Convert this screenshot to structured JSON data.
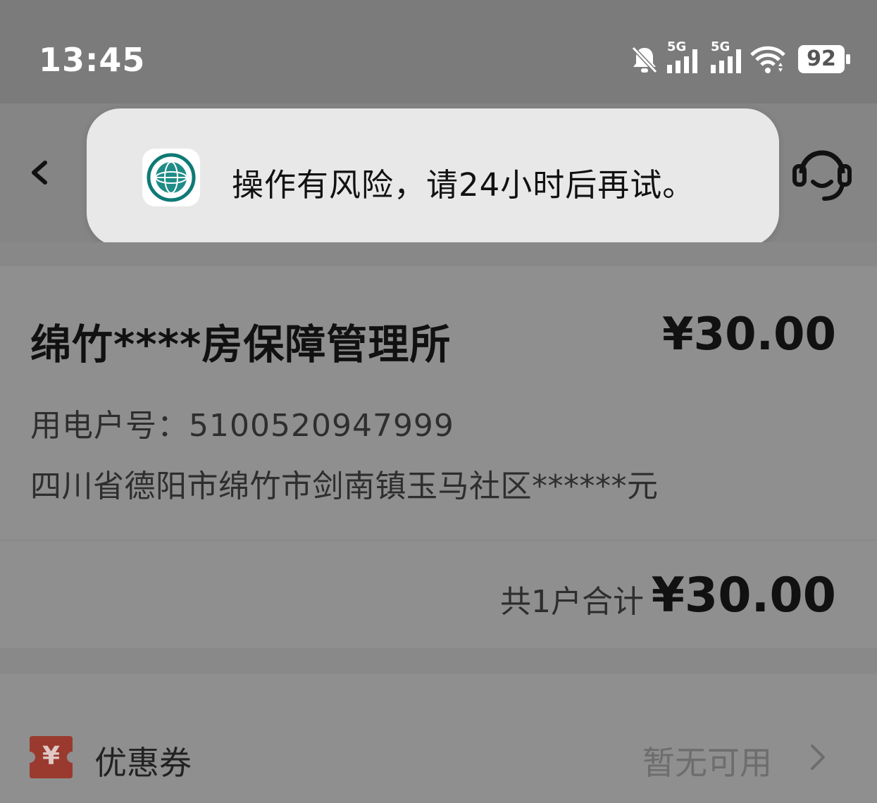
{
  "status_bar": {
    "time": "13:45",
    "network_1": "5G",
    "network_2": "5G",
    "battery": "92",
    "icons": [
      "bell-off-icon",
      "signal-5g-icon",
      "signal-5g-icon",
      "wifi-icon",
      "battery-icon"
    ]
  },
  "nav": {
    "back_icon": "chevron-left-icon",
    "service_icon": "headset-icon"
  },
  "toast": {
    "message": "操作有风险，请24小时后再试。",
    "logo_icon": "state-grid-logo"
  },
  "bill": {
    "account_name": "绵竹****房保障管理所",
    "amount": "¥30.00",
    "account_number": "用电户号：5100520947999",
    "address": "四川省德阳市绵竹市剑南镇玉马社区******元"
  },
  "total": {
    "label": "共1户合计",
    "amount": "¥30.00"
  },
  "coupon": {
    "label": "优惠券",
    "status": "暂无可用",
    "icon_symbol": "¥",
    "icon": "coupon-icon",
    "icon_color": "#9a3a2f"
  }
}
